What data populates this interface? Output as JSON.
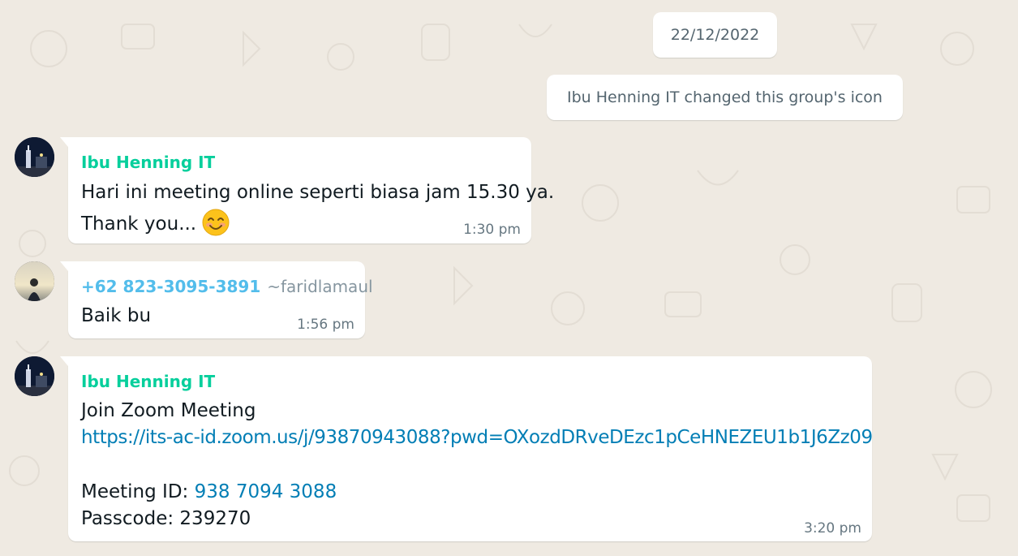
{
  "colors": {
    "chat_background": "#efeae2",
    "bubble": "#ffffff",
    "sender_green": "#06cf9c",
    "sender_blue": "#53bdeb",
    "link": "#027eb5",
    "meta_text": "#667781"
  },
  "chat": {
    "date_chip": "22/12/2022",
    "system_message": "Ibu Henning IT changed this group's icon",
    "messages": [
      {
        "sender": "Ibu Henning IT",
        "avatar_icon": "avatar-icon",
        "lines": [
          "Hari ini meeting online seperti biasa jam 15.30 ya.",
          "Thank you..."
        ],
        "emoji": "smiling-face-icon",
        "time": "1:30 pm"
      },
      {
        "sender": "+62 823-3095-3891",
        "handle": "~faridlamaul",
        "avatar_icon": "avatar-icon",
        "lines": [
          "Baik bu"
        ],
        "time": "1:56 pm"
      },
      {
        "sender": "Ibu Henning IT",
        "avatar_icon": "avatar-icon",
        "title": "Join Zoom Meeting",
        "link": "https://its-ac-id.zoom.us/j/93870943088?pwd=OXozdDRveDEzc1pCeHNEZEU1b1J6Zz09",
        "meeting_id_label": "Meeting ID: ",
        "meeting_id": "938 7094 3088",
        "passcode": "Passcode: 239270",
        "time": "3:20 pm"
      }
    ]
  }
}
